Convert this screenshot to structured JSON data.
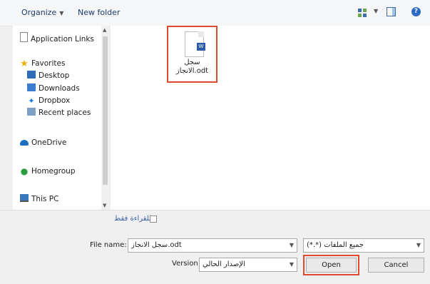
{
  "toolbar": {
    "organize_label": "Organize",
    "new_folder_label": "New folder"
  },
  "nav": {
    "items": [
      {
        "label": "Application Links",
        "icon": "document-icon"
      },
      {
        "label": "Favorites",
        "icon": "star-icon"
      },
      {
        "label": "Desktop",
        "icon": "desktop-icon"
      },
      {
        "label": "Downloads",
        "icon": "downloads-icon"
      },
      {
        "label": "Dropbox",
        "icon": "dropbox-icon"
      },
      {
        "label": "Recent places",
        "icon": "recent-places-icon"
      },
      {
        "label": "OneDrive",
        "icon": "onedrive-icon"
      },
      {
        "label": "Homegroup",
        "icon": "homegroup-icon"
      },
      {
        "label": "This PC",
        "icon": "this-pc-icon"
      }
    ]
  },
  "files": [
    {
      "name_line1": "سجل",
      "name_line2": "الانجاز.odt",
      "type_badge": "W"
    }
  ],
  "bottom": {
    "readonly_label": "للقراءة فقط",
    "file_name_label": "File name:",
    "file_name_value": "سجل الانجاز.odt",
    "file_type_value": "(*.*) جميع الملفات",
    "version_label": "Version",
    "version_value": "الإصدار الحالي",
    "open_label": "Open",
    "cancel_label": "Cancel"
  },
  "colors": {
    "highlight": "#e0492f",
    "link": "#3a5fa8"
  }
}
